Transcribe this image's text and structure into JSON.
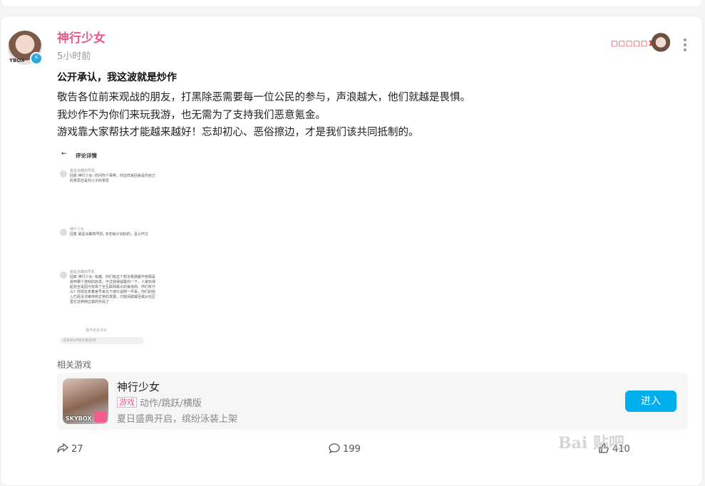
{
  "post": {
    "author": "神行少女",
    "time": "5小时前",
    "avatar_tag": "YBOX",
    "badge_text": "□□□□□1",
    "title": "公开承认，我这波就是炒作",
    "body_lines": [
      "敬告各位前来观战的朋友，打黑除恶需要每一位公民的参与，声浪越大，他们就越是畏惧。",
      "我炒作不为你们来玩我游，也无需为了支持我们恶意氪金。",
      "游戏靠大家帮扶才能越来越好！忘却初心、恶俗擦边，才是我们该共同抵制的。"
    ]
  },
  "screenshot": {
    "header": "评论详情",
    "comments": [
      {
        "name": "最星派聚四号机",
        "text": "回复 神行少女: 你问你个事啊，你这样来回来是你自己的意思还是你儿子的意思"
      },
      {
        "name": "神行少女",
        "text": "回复 最星派聚四号机: 年初就计划好的，且公开过"
      },
      {
        "name": "最星派聚四号机",
        "text": "回复 神行少女: 有趣。你们有这个想法我猜都不用猜是受到哪个游戏的启发。不过我得提醒你一下，人家玩得起完全是因为背靠了全互联网最大的渠道商。你们有什么？你现在拿着官号来在下坡只说明一件事，你们的收入已经没法维持到正常的发展，只能另辟蹊径或从社区里打这种擦边激的手段了"
      }
    ],
    "expand": "展开更多评论",
    "input_placeholder": "请来和UP给你最高吧"
  },
  "related": {
    "label": "相关游戏",
    "game_name": "神行少女",
    "tag": "游戏",
    "genre": "动作/跳跃/横版",
    "desc": "夏日盛典开启，缤纷泳装上架",
    "cover_label": "SKYBOX",
    "enter_label": "进入"
  },
  "actions": {
    "share_count": "27",
    "comment_count": "199",
    "like_count": "410"
  },
  "watermark": "Bai 贴吧",
  "colors": {
    "author": "#e85a8a",
    "accent": "#00aeec",
    "verify": "#2aa8e0"
  }
}
